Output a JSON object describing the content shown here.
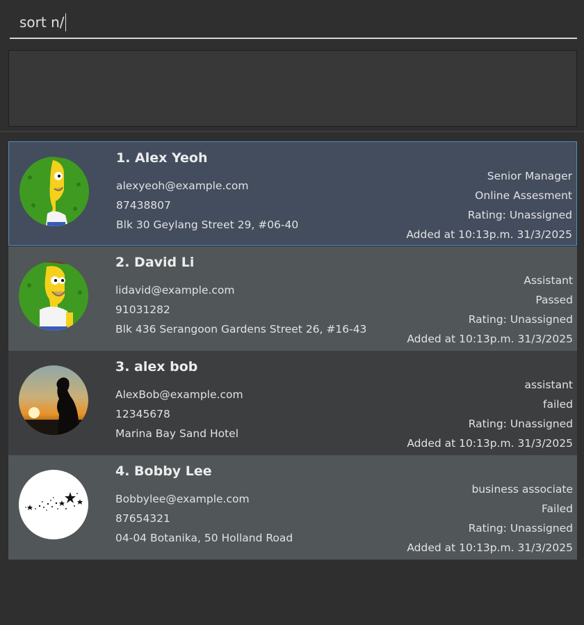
{
  "command": {
    "value": "sort n/"
  },
  "result": {
    "text": ""
  },
  "persons": [
    {
      "index_name": "1. Alex Yeoh",
      "email": "alexyeoh@example.com",
      "phone": "87438807",
      "address": "Blk 30 Geylang Street 29, #06-40",
      "role": "Senior Manager",
      "status": "Online Assesment",
      "rating": "Rating: Unassigned",
      "added": "Added at 10:13p.m. 31/3/2025",
      "avatar_icon": "homer-bush-avatar"
    },
    {
      "index_name": "2. David Li",
      "email": "lidavid@example.com",
      "phone": "91031282",
      "address": "Blk 436 Serangoon Gardens Street 26, #16-43",
      "role": "Assistant",
      "status": "Passed",
      "rating": "Rating: Unassigned",
      "added": "Added at 10:13p.m. 31/3/2025",
      "avatar_icon": "homer-bush-avatar"
    },
    {
      "index_name": "3. alex bob",
      "email": "AlexBob@example.com",
      "phone": "12345678",
      "address": "Marina Bay Sand Hotel",
      "role": "assistant",
      "status": "failed",
      "rating": "Rating: Unassigned",
      "added": "Added at 10:13p.m. 31/3/2025",
      "avatar_icon": "sunset-silhouette-avatar"
    },
    {
      "index_name": "4. Bobby Lee",
      "email": "Bobbylee@example.com",
      "phone": "87654321",
      "address": "04-04 Botanika, 50 Holland Road",
      "role": "business associate",
      "status": "Failed",
      "rating": "Rating: Unassigned",
      "added": "Added at 10:13p.m. 31/3/2025",
      "avatar_icon": "stars-avatar"
    }
  ]
}
